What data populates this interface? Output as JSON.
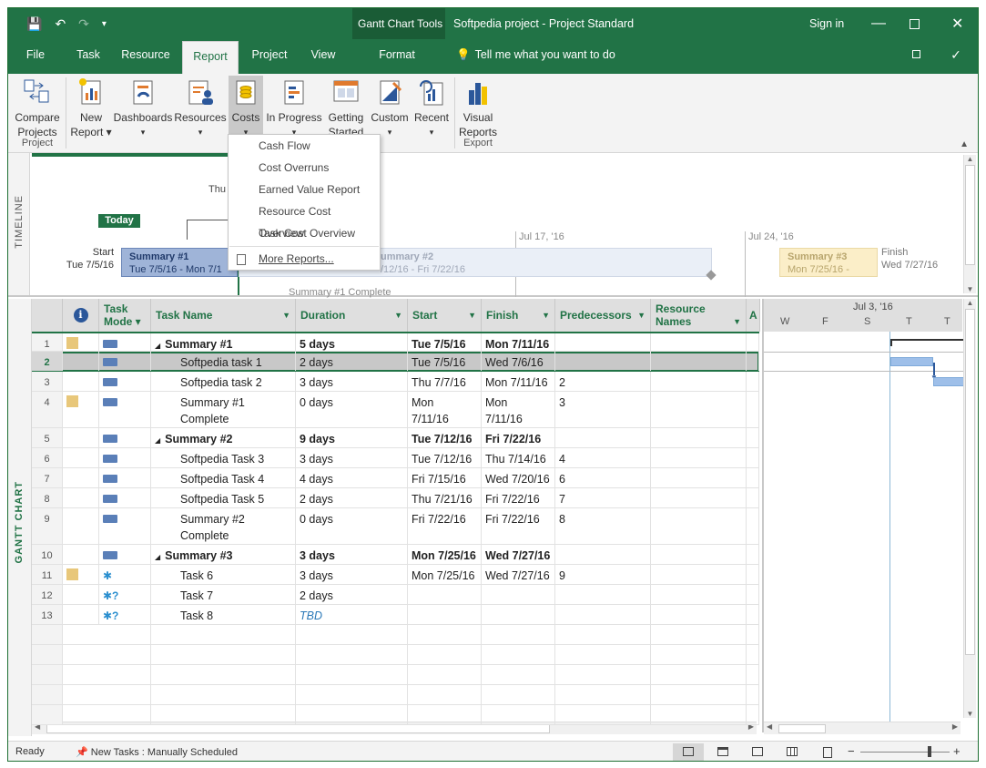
{
  "titlebar": {
    "context_tab": "Gantt Chart Tools",
    "title": "Softpedia project - Project Standard",
    "sign_in": "Sign in",
    "qat_save": "💾",
    "qat_undo": "↶",
    "qat_redo": "↷"
  },
  "tabs": {
    "file": "File",
    "task": "Task",
    "resource": "Resource",
    "report": "Report",
    "project": "Project",
    "view": "View",
    "format": "Format",
    "tell_me": "Tell me what you want to do"
  },
  "ribbon": {
    "compare_l1": "Compare",
    "compare_l2": "Projects",
    "new_l1": "New",
    "new_l2": "Report ▾",
    "dashboards": "Dashboards",
    "resources": "Resources",
    "costs": "Costs",
    "in_progress": "In Progress",
    "getting_l1": "Getting",
    "getting_l2": "Started ▾",
    "custom": "Custom",
    "recent": "Recent",
    "visual_l1": "Visual",
    "visual_l2": "Reports",
    "group_project": "Project",
    "group_export": "Export"
  },
  "costs_menu": {
    "items": [
      "Cash Flow",
      "Cost Overruns",
      "Earned Value Report",
      "Resource Cost Overview",
      "Task Cost Overview"
    ],
    "more": "More Reports..."
  },
  "timeline": {
    "label": "TIMELINE",
    "thu": "Thu",
    "today": "Today",
    "start_label": "Start",
    "start_date": "Tue 7/5/16",
    "tick1": "Jul 17, '16",
    "tick2": "Jul 24, '16",
    "finish_label": "Finish",
    "finish_date": "Wed 7/27/16",
    "s1_name": "Summary #1",
    "s1_dates": "Tue 7/5/16 - Mon 7/1",
    "s2_name": "ummary #2",
    "s2_dates": "/12/16 - Fri 7/22/16",
    "s3_name": "Summary #3",
    "s3_dates": "Mon 7/25/16 -",
    "milestone": "Summary #1 Complete"
  },
  "gantt": {
    "label": "GANTT CHART",
    "headers": {
      "info": "i",
      "mode_l1": "Task",
      "mode_l2": "Mode ▾",
      "name": "Task Name",
      "duration": "Duration",
      "start": "Start",
      "finish": "Finish",
      "pred": "Predecessors",
      "res_l1": "Resource",
      "res_l2": "Names",
      "add": "A"
    },
    "chart_header": {
      "week": "Jul 3, '16",
      "days": [
        "W",
        "F",
        "S",
        "T",
        "T"
      ]
    },
    "rows": [
      {
        "id": "1",
        "name": "Summary #1",
        "duration": "5 days",
        "start": "Tue 7/5/16",
        "finish": "Mon 7/11/16",
        "pred": ""
      },
      {
        "id": "2",
        "name": "Softpedia task 1",
        "duration": "2 days",
        "start": "Tue 7/5/16",
        "finish": "Wed 7/6/16",
        "pred": ""
      },
      {
        "id": "3",
        "name": "Softpedia task 2",
        "duration": "3 days",
        "start": "Thu 7/7/16",
        "finish": "Mon 7/11/16",
        "pred": "2"
      },
      {
        "id": "4",
        "name1": "Summary #1",
        "name2": "Complete",
        "duration": "0 days",
        "start1": "Mon",
        "start2": "7/11/16",
        "finish1": "Mon",
        "finish2": "7/11/16",
        "pred": "3"
      },
      {
        "id": "5",
        "name": "Summary #2",
        "duration": "9 days",
        "start": "Tue 7/12/16",
        "finish": "Fri 7/22/16",
        "pred": ""
      },
      {
        "id": "6",
        "name": "Softpedia Task 3",
        "duration": "3 days",
        "start": "Tue 7/12/16",
        "finish": "Thu 7/14/16",
        "pred": "4"
      },
      {
        "id": "7",
        "name": "Softpedia Task 4",
        "duration": "4 days",
        "start": "Fri 7/15/16",
        "finish": "Wed 7/20/16",
        "pred": "6"
      },
      {
        "id": "8",
        "name": "Softpedia Task 5",
        "duration": "2 days",
        "start": "Thu 7/21/16",
        "finish": "Fri 7/22/16",
        "pred": "7"
      },
      {
        "id": "9",
        "name1": "Summary #2",
        "name2": "Complete",
        "duration": "0 days",
        "start": "Fri 7/22/16",
        "finish": "Fri 7/22/16",
        "pred": "8"
      },
      {
        "id": "10",
        "name": "Summary #3",
        "duration": "3 days",
        "start": "Mon 7/25/16",
        "finish": "Wed 7/27/16",
        "pred": ""
      },
      {
        "id": "11",
        "name": "Task 6",
        "duration": "3 days",
        "start": "Mon 7/25/16",
        "finish": "Wed 7/27/16",
        "pred": "9"
      },
      {
        "id": "12",
        "name": "Task 7",
        "duration": "2 days",
        "start": "",
        "finish": "",
        "pred": ""
      },
      {
        "id": "13",
        "name": "Task 8",
        "duration": "TBD",
        "start": "",
        "finish": "",
        "pred": ""
      }
    ]
  },
  "status": {
    "ready": "Ready",
    "new_tasks": "New Tasks : Manually Scheduled"
  }
}
